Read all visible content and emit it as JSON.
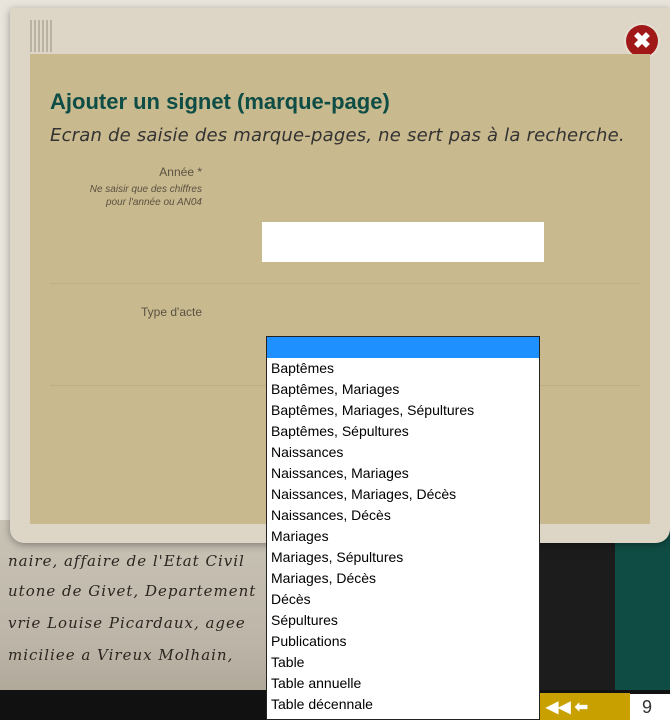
{
  "background": {
    "script_lines": [
      "naire, affaire de l'Etat Civil",
      "utone de Givet, Departement",
      "vrie Louise Picardaux, agee",
      "miciliee a Vireux Molhain,"
    ],
    "page_number_partial": "9"
  },
  "modal": {
    "title": "Ajouter un signet (marque-page)",
    "subtitle": "Ecran de saisie des marque-pages, ne sert pas à la recherche.",
    "annee": {
      "label": "Année *",
      "help_line1": "Ne saisir que des chiffres",
      "help_line2": "pour l'année ou AN04",
      "value": ""
    },
    "type_acte": {
      "label": "Type d'acte",
      "options": [
        "",
        "Baptêmes",
        "Baptêmes, Mariages",
        "Baptêmes, Mariages, Sépultures",
        "Baptêmes, Sépultures",
        "Naissances",
        "Naissances, Mariages",
        "Naissances, Mariages, Décès",
        "Naissances, Décès",
        "Mariages",
        "Mariages, Sépultures",
        "Mariages, Décès",
        "Décès",
        "Sépultures",
        "Publications",
        "Table",
        "Table annuelle",
        "Table décennale"
      ],
      "selected_index": 0
    }
  },
  "icons": {
    "close": "close-circle-icon",
    "first_page": "double-arrow-left-icon",
    "prev_page": "arrow-left-icon"
  },
  "colors": {
    "title": "#0e4d45",
    "modal_body": "#c9b98e",
    "close_button": "#a01818",
    "selection": "#1e90ff"
  }
}
